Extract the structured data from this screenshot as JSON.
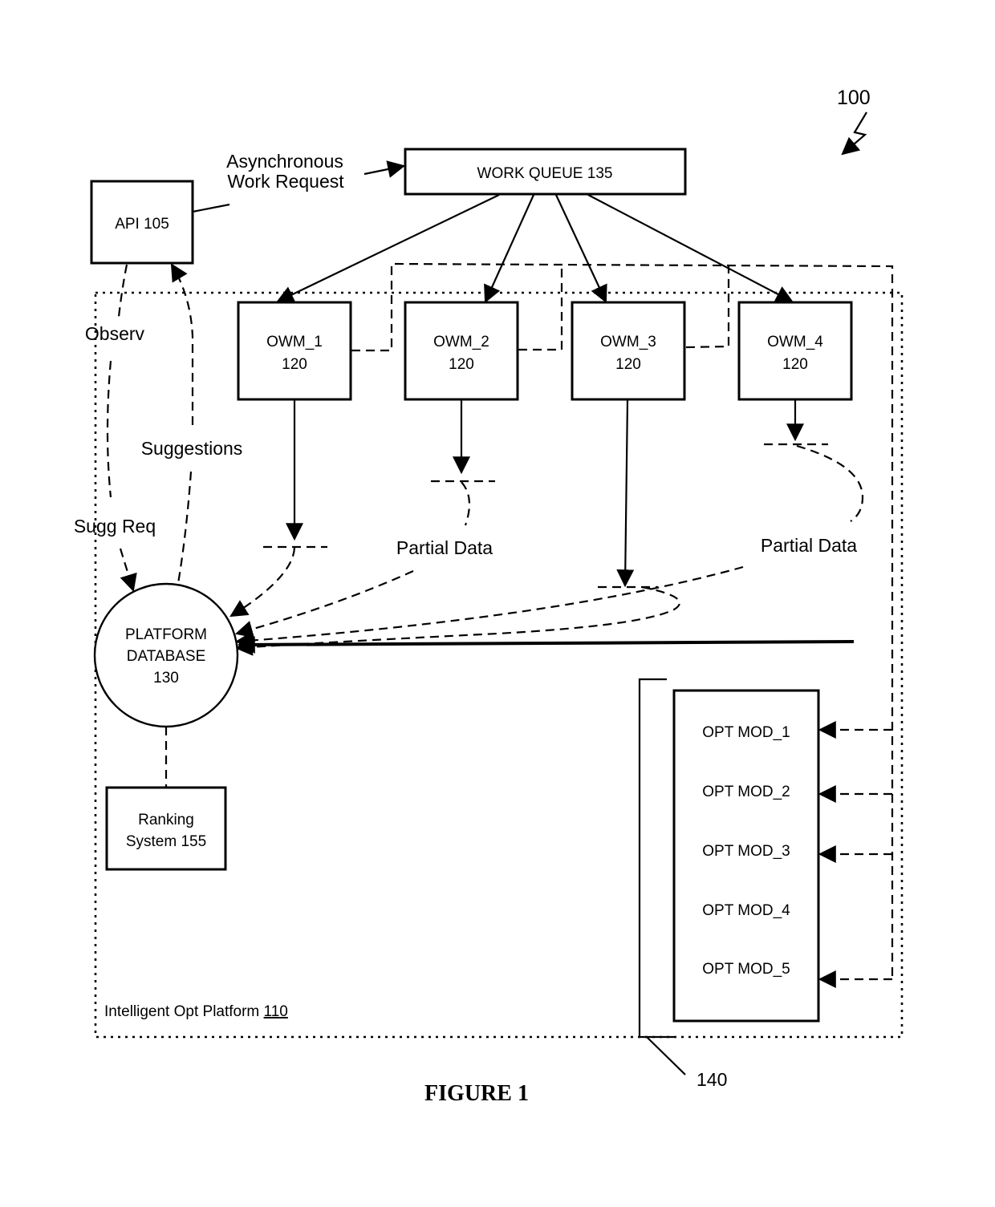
{
  "figure": {
    "ref_number": "100",
    "caption": "FIGURE 1"
  },
  "nodes": {
    "api": {
      "label": "API 105"
    },
    "work_queue": {
      "label": "WORK QUEUE 135"
    },
    "owm": [
      {
        "name": "OWM_1",
        "ref": "120"
      },
      {
        "name": "OWM_2",
        "ref": "120"
      },
      {
        "name": "OWM_3",
        "ref": "120"
      },
      {
        "name": "OWM_4",
        "ref": "120"
      }
    ],
    "database": {
      "line1": "PLATFORM",
      "line2": "DATABASE",
      "line3": "130"
    },
    "ranking": {
      "line1": "Ranking",
      "line2": "System 155"
    },
    "opt_modules": [
      "OPT MOD_1",
      "OPT MOD_2",
      "OPT MOD_3",
      "OPT MOD_4",
      "OPT MOD_5"
    ],
    "opt_group_ref": "140",
    "platform": {
      "label": "Intelligent Opt Platform ",
      "ref": "110"
    }
  },
  "edge_labels": {
    "async_line1": "Asynchronous",
    "async_line2": "Work Request",
    "observ": "Observ",
    "suggestions": "Suggestions",
    "sugg_req": "Sugg Req",
    "partial_data_1": "Partial Data",
    "partial_data_2": "Partial Data"
  }
}
